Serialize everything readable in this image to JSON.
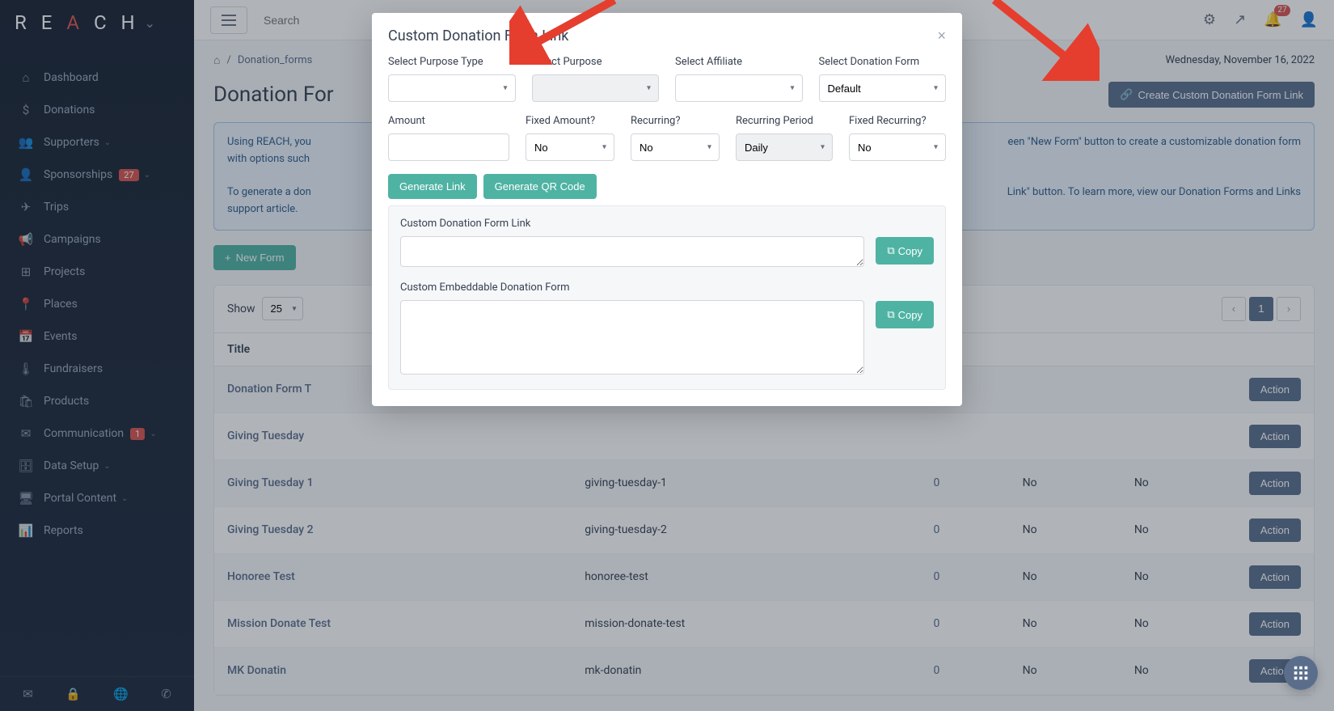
{
  "logo": {
    "text": "REACH"
  },
  "sidebar": {
    "items": [
      {
        "icon": "⌂",
        "label": "Dashboard"
      },
      {
        "icon": "$",
        "label": "Donations"
      },
      {
        "icon": "👥",
        "label": "Supporters",
        "caret": true
      },
      {
        "icon": "👤",
        "label": "Sponsorships",
        "badge": "27",
        "caret": true
      },
      {
        "icon": "✈",
        "label": "Trips"
      },
      {
        "icon": "📢",
        "label": "Campaigns"
      },
      {
        "icon": "⊞",
        "label": "Projects"
      },
      {
        "icon": "📍",
        "label": "Places"
      },
      {
        "icon": "📅",
        "label": "Events"
      },
      {
        "icon": "🌡",
        "label": "Fundraisers"
      },
      {
        "icon": "🛍",
        "label": "Products"
      },
      {
        "icon": "✉",
        "label": "Communication",
        "badge": "1",
        "caret": true
      },
      {
        "icon": "🗄",
        "label": "Data Setup",
        "caret": true
      },
      {
        "icon": "🖥",
        "label": "Portal Content",
        "caret": true
      },
      {
        "icon": "📊",
        "label": "Reports"
      }
    ]
  },
  "topbar": {
    "search_placeholder": "Search",
    "notif_badge": "27"
  },
  "breadcrumb": {
    "item": "Donation_forms"
  },
  "date": "Wednesday, November 16, 2022",
  "page": {
    "title": "Donation For",
    "create_link_btn": "Create Custom Donation Form Link",
    "new_form_btn": "New Form"
  },
  "info": {
    "line1_a": "Using REACH, you",
    "line1_b": "een \"New Form\" button to create a customizable donation form",
    "line2": "with options such",
    "line3_a": "To generate a don",
    "line3_b": "Link\" button. To learn more, view our ",
    "line3_link": "Donation Forms and Links",
    "line4": "support article."
  },
  "table": {
    "show_label": "Show",
    "page_size": "25",
    "page_current": "1",
    "headers": [
      "Title"
    ],
    "action_label": "Action",
    "rows": [
      {
        "title": "Donation Form T",
        "alt": true
      },
      {
        "title": "Giving Tuesday"
      },
      {
        "title": "Giving Tuesday 1",
        "slug": "giving-tuesday-1",
        "count": "0",
        "c1": "No",
        "c2": "No",
        "alt": true
      },
      {
        "title": "Giving Tuesday 2",
        "slug": "giving-tuesday-2",
        "count": "0",
        "c1": "No",
        "c2": "No"
      },
      {
        "title": "Honoree Test",
        "slug": "honoree-test",
        "count": "0",
        "c1": "No",
        "c2": "No",
        "alt": true
      },
      {
        "title": "Mission Donate Test",
        "slug": "mission-donate-test",
        "count": "0",
        "c1": "No",
        "c2": "No"
      },
      {
        "title": "MK Donatin",
        "slug": "mk-donatin",
        "count": "0",
        "c1": "No",
        "c2": "No",
        "alt": true
      }
    ]
  },
  "modal": {
    "title": "Custom Donation Form Link",
    "labels": {
      "purpose_type": "Select Purpose Type",
      "purpose": "Select Purpose",
      "affiliate": "Select Affiliate",
      "donation_form": "Select Donation Form",
      "amount": "Amount",
      "fixed_amount": "Fixed Amount?",
      "recurring": "Recurring?",
      "recurring_period": "Recurring Period",
      "fixed_recurring": "Fixed Recurring?"
    },
    "values": {
      "donation_form": "Default",
      "fixed_amount": "No",
      "recurring": "No",
      "recurring_period": "Daily",
      "fixed_recurring": "No"
    },
    "buttons": {
      "gen_link": "Generate Link",
      "gen_qr": "Generate QR Code",
      "copy": "Copy"
    },
    "output": {
      "link_label": "Custom Donation Form Link",
      "embed_label": "Custom Embeddable Donation Form"
    }
  }
}
